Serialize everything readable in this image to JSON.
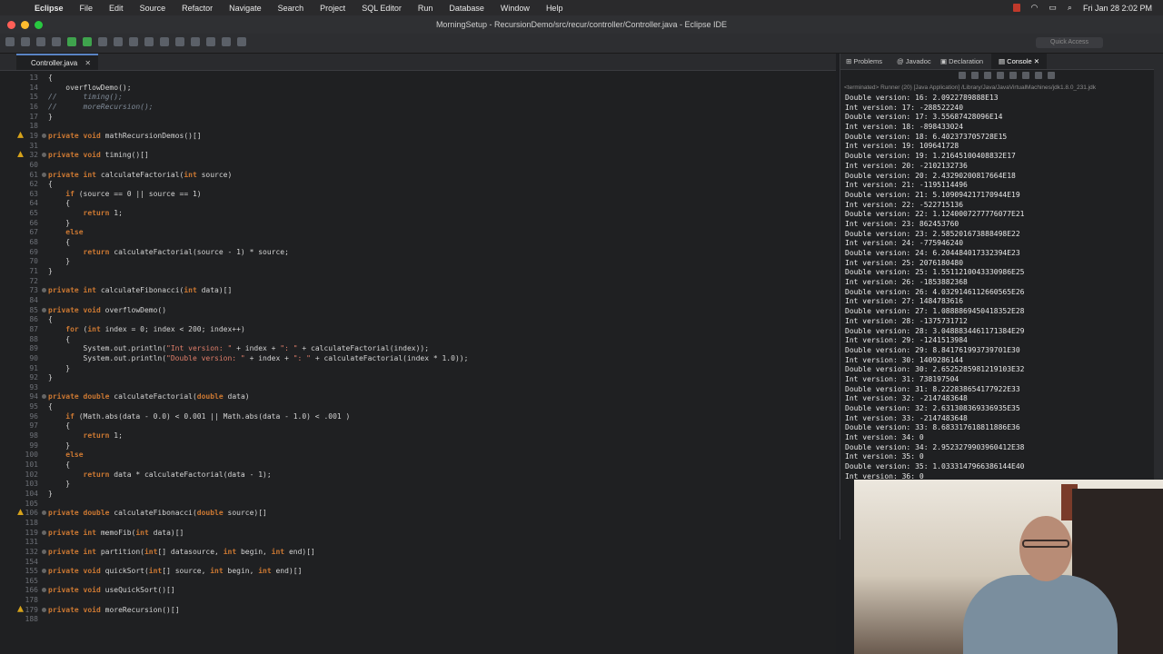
{
  "menubar": {
    "app_name": "Eclipse",
    "items": [
      "File",
      "Edit",
      "Source",
      "Refactor",
      "Navigate",
      "Search",
      "Project",
      "SQL Editor",
      "Run",
      "Database",
      "Window",
      "Help"
    ],
    "datetime": "Fri Jan 28  2:02 PM"
  },
  "window": {
    "title": "MorningSetup - RecursionDemo/src/recur/controller/Controller.java - Eclipse IDE"
  },
  "toolbar": {
    "quick_access": "Quick Access"
  },
  "editor": {
    "tab_label": "Controller.java",
    "tab_close": "✕",
    "lines": [
      {
        "n": "13",
        "text": "{"
      },
      {
        "n": "14",
        "text": "    overflowDemo();"
      },
      {
        "n": "15",
        "text": "//      timing();"
      },
      {
        "n": "16",
        "text": "//      moreRecursion();"
      },
      {
        "n": "17",
        "text": "}"
      },
      {
        "n": "18",
        "text": ""
      },
      {
        "n": "19",
        "text": "private void mathRecursionDemos()[]"
      },
      {
        "n": "31",
        "text": ""
      },
      {
        "n": "32",
        "text": "private void timing()[]"
      },
      {
        "n": "60",
        "text": ""
      },
      {
        "n": "61",
        "text": "private int calculateFactorial(int source)"
      },
      {
        "n": "62",
        "text": "{"
      },
      {
        "n": "63",
        "text": "    if (source == 0 || source == 1)"
      },
      {
        "n": "64",
        "text": "    {"
      },
      {
        "n": "65",
        "text": "        return 1;"
      },
      {
        "n": "66",
        "text": "    }"
      },
      {
        "n": "67",
        "text": "    else"
      },
      {
        "n": "68",
        "text": "    {"
      },
      {
        "n": "69",
        "text": "        return calculateFactorial(source - 1) * source;"
      },
      {
        "n": "70",
        "text": "    }"
      },
      {
        "n": "71",
        "text": "}"
      },
      {
        "n": "72",
        "text": ""
      },
      {
        "n": "73",
        "text": "private int calculateFibonacci(int data)[]"
      },
      {
        "n": "84",
        "text": ""
      },
      {
        "n": "85",
        "text": "private void overflowDemo()"
      },
      {
        "n": "86",
        "text": "{"
      },
      {
        "n": "87",
        "text": "    for (int index = 0; index < 200; index++)"
      },
      {
        "n": "88",
        "text": "    {"
      },
      {
        "n": "89",
        "text": "        System.out.println(\"Int version: \" + index + \": \" + calculateFactorial(index));"
      },
      {
        "n": "90",
        "text": "        System.out.println(\"Double version: \" + index + \": \" + calculateFactorial(index * 1.0));"
      },
      {
        "n": "91",
        "text": "    }"
      },
      {
        "n": "92",
        "text": "}"
      },
      {
        "n": "93",
        "text": ""
      },
      {
        "n": "94",
        "text": "private double calculateFactorial(double data)"
      },
      {
        "n": "95",
        "text": "{"
      },
      {
        "n": "96",
        "text": "    if (Math.abs(data - 0.0) < 0.001 || Math.abs(data - 1.0) < .001 )"
      },
      {
        "n": "97",
        "text": "    {"
      },
      {
        "n": "98",
        "text": "        return 1;"
      },
      {
        "n": "99",
        "text": "    }"
      },
      {
        "n": "100",
        "text": "    else"
      },
      {
        "n": "101",
        "text": "    {"
      },
      {
        "n": "102",
        "text": "        return data * calculateFactorial(data - 1);"
      },
      {
        "n": "103",
        "text": "    }"
      },
      {
        "n": "104",
        "text": "}"
      },
      {
        "n": "105",
        "text": ""
      },
      {
        "n": "106",
        "text": "private double calculateFibonacci(double source)[]"
      },
      {
        "n": "118",
        "text": ""
      },
      {
        "n": "119",
        "text": "private int memoFib(int data)[]"
      },
      {
        "n": "131",
        "text": ""
      },
      {
        "n": "132",
        "text": "private int partition(int[] datasource, int begin, int end)[]"
      },
      {
        "n": "154",
        "text": ""
      },
      {
        "n": "155",
        "text": "private void quickSort(int[] source, int begin, int end)[]"
      },
      {
        "n": "165",
        "text": ""
      },
      {
        "n": "166",
        "text": "private void useQuickSort()[]"
      },
      {
        "n": "178",
        "text": ""
      },
      {
        "n": "179",
        "text": "private void moreRecursion()[]"
      },
      {
        "n": "188",
        "text": ""
      }
    ]
  },
  "console_panel": {
    "tabs": [
      "Problems",
      "Javadoc",
      "Declaration",
      "Console"
    ],
    "close": "✕",
    "status": "<terminated> Runner (20) [Java Application] /Library/Java/JavaVirtualMachines/jdk1.8.0_231.jdk",
    "lines": [
      "Double version: 16: 2.0922789888E13",
      "Int version: 17: -288522240",
      "Double version: 17: 3.55687428096E14",
      "Int version: 18: -898433024",
      "Double version: 18: 6.402373705728E15",
      "Int version: 19: 109641728",
      "Double version: 19: 1.21645100408832E17",
      "Int version: 20: -2102132736",
      "Double version: 20: 2.43290200817664E18",
      "Int version: 21: -1195114496",
      "Double version: 21: 5.109094217170944E19",
      "Int version: 22: -522715136",
      "Double version: 22: 1.1240007277776077E21",
      "Int version: 23: 862453760",
      "Double version: 23: 2.585201673888498E22",
      "Int version: 24: -775946240",
      "Double version: 24: 6.204484017332394E23",
      "Int version: 25: 2076180480",
      "Double version: 25: 1.5511210043330986E25",
      "Int version: 26: -1853882368",
      "Double version: 26: 4.0329146112660565E26",
      "Int version: 27: 1484783616",
      "Double version: 27: 1.0888869450418352E28",
      "Int version: 28: -1375731712",
      "Double version: 28: 3.0488834461171384E29",
      "Int version: 29: -1241513984",
      "Double version: 29: 8.841761993739701E30",
      "Int version: 30: 1409286144",
      "Double version: 30: 2.6525285981219103E32",
      "Int version: 31: 738197504",
      "Double version: 31: 8.222838654177922E33",
      "Int version: 32: -2147483648",
      "Double version: 32: 2.631308369336935E35",
      "Int version: 33: -2147483648",
      "Double version: 33: 8.683317618811886E36",
      "Int version: 34: 0",
      "Double version: 34: 2.9523279903960412E38",
      "Int version: 35: 0",
      "Double version: 35: 1.0333147966386144E40",
      "Int version: 36: 0"
    ]
  },
  "colors": {
    "keyword": "#cc7832",
    "comment": "#7f8a97",
    "string": "#e07e6a",
    "variable": "#e8a3d6",
    "tab_accent": "#5a84c5",
    "warning": "#d6a21a"
  }
}
